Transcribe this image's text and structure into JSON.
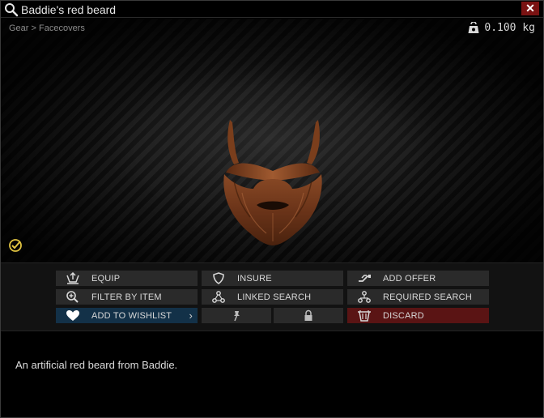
{
  "window": {
    "title": "Baddie's red beard",
    "close_label": "✕"
  },
  "preview": {
    "breadcrumb": "Gear > Facecovers",
    "weight": "0.100 kg"
  },
  "actions": {
    "equip": "EQUIP",
    "insure": "INSURE",
    "add_offer": "ADD OFFER",
    "filter_by_item": "FILTER BY ITEM",
    "linked_search": "LINKED SEARCH",
    "required_search": "REQUIRED SEARCH",
    "add_to_wishlist": "ADD TO WISHLIST",
    "wishlist_chevron": "›",
    "discard": "DISCARD"
  },
  "description": "An artificial red beard from Baddie.",
  "colors": {
    "wishlist_button": "#133148",
    "discard_button": "#5a1414",
    "close_button": "#7a1212",
    "examined_icon": "#e0c341"
  }
}
